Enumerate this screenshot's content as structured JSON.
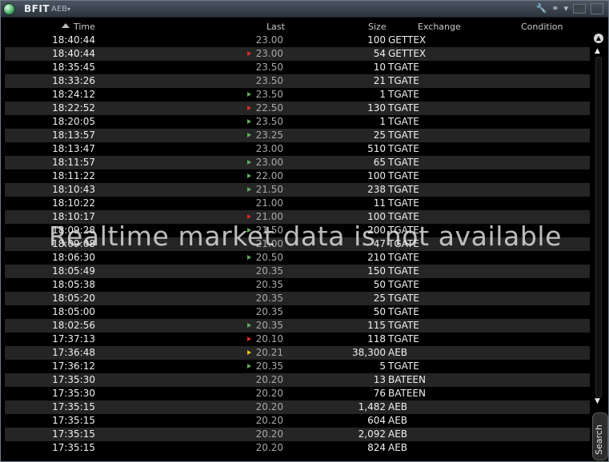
{
  "window": {
    "symbol": "BFIT",
    "exchange_selector": "AEB",
    "caret": "▾",
    "icons": [
      "wrench-icon",
      "link-icon",
      "minimize-icon",
      "maximize-icon"
    ]
  },
  "columns": {
    "time": "Time",
    "last": "Last",
    "size": "Size",
    "exchange": "Exchange",
    "condition": "Condition"
  },
  "colors": {
    "up_tick": "#5fae5f",
    "down_tick": "#e02828",
    "unchanged_tick": "#e8c21c",
    "row_alt": "#252525"
  },
  "trades": [
    {
      "time": "18:40:44",
      "last": "23.00",
      "size": "100",
      "exchange": "GETTEX",
      "tick": ""
    },
    {
      "time": "18:40:44",
      "last": "23.00",
      "size": "54",
      "exchange": "GETTEX",
      "tick": "down"
    },
    {
      "time": "18:35:45",
      "last": "23.50",
      "size": "10",
      "exchange": "TGATE",
      "tick": ""
    },
    {
      "time": "18:33:26",
      "last": "23.50",
      "size": "21",
      "exchange": "TGATE",
      "tick": ""
    },
    {
      "time": "18:24:12",
      "last": "23.50",
      "size": "1",
      "exchange": "TGATE",
      "tick": "up"
    },
    {
      "time": "18:22:52",
      "last": "22.50",
      "size": "130",
      "exchange": "TGATE",
      "tick": "down"
    },
    {
      "time": "18:20:05",
      "last": "23.50",
      "size": "1",
      "exchange": "TGATE",
      "tick": "up"
    },
    {
      "time": "18:13:57",
      "last": "23.25",
      "size": "25",
      "exchange": "TGATE",
      "tick": "up"
    },
    {
      "time": "18:13:47",
      "last": "23.00",
      "size": "510",
      "exchange": "TGATE",
      "tick": ""
    },
    {
      "time": "18:11:57",
      "last": "23.00",
      "size": "65",
      "exchange": "TGATE",
      "tick": "up"
    },
    {
      "time": "18:11:22",
      "last": "22.00",
      "size": "100",
      "exchange": "TGATE",
      "tick": "up"
    },
    {
      "time": "18:10:43",
      "last": "21.50",
      "size": "238",
      "exchange": "TGATE",
      "tick": "up"
    },
    {
      "time": "18:10:22",
      "last": "21.00",
      "size": "11",
      "exchange": "TGATE",
      "tick": ""
    },
    {
      "time": "18:10:17",
      "last": "21.00",
      "size": "100",
      "exchange": "TGATE",
      "tick": "down"
    },
    {
      "time": "18:09:28",
      "last": "21.50",
      "size": "200",
      "exchange": "TGATE",
      "tick": "up"
    },
    {
      "time": "18:09:08",
      "last": "21.00",
      "size": "47",
      "exchange": "TGATE",
      "tick": ""
    },
    {
      "time": "18:06:30",
      "last": "20.50",
      "size": "210",
      "exchange": "TGATE",
      "tick": "up"
    },
    {
      "time": "18:05:49",
      "last": "20.35",
      "size": "150",
      "exchange": "TGATE",
      "tick": ""
    },
    {
      "time": "18:05:38",
      "last": "20.35",
      "size": "50",
      "exchange": "TGATE",
      "tick": ""
    },
    {
      "time": "18:05:20",
      "last": "20.35",
      "size": "25",
      "exchange": "TGATE",
      "tick": ""
    },
    {
      "time": "18:05:00",
      "last": "20.35",
      "size": "50",
      "exchange": "TGATE",
      "tick": ""
    },
    {
      "time": "18:02:56",
      "last": "20.35",
      "size": "115",
      "exchange": "TGATE",
      "tick": "up"
    },
    {
      "time": "17:37:13",
      "last": "20.10",
      "size": "118",
      "exchange": "TGATE",
      "tick": "down"
    },
    {
      "time": "17:36:48",
      "last": "20.21",
      "size": "38,300",
      "exchange": "AEB",
      "tick": "flat"
    },
    {
      "time": "17:36:12",
      "last": "20.35",
      "size": "5",
      "exchange": "TGATE",
      "tick": "up"
    },
    {
      "time": "17:35:30",
      "last": "20.20",
      "size": "13",
      "exchange": "BATEEN",
      "tick": ""
    },
    {
      "time": "17:35:30",
      "last": "20.20",
      "size": "76",
      "exchange": "BATEEN",
      "tick": ""
    },
    {
      "time": "17:35:15",
      "last": "20.20",
      "size": "1,482",
      "exchange": "AEB",
      "tick": ""
    },
    {
      "time": "17:35:15",
      "last": "20.20",
      "size": "604",
      "exchange": "AEB",
      "tick": ""
    },
    {
      "time": "17:35:15",
      "last": "20.20",
      "size": "2,092",
      "exchange": "AEB",
      "tick": ""
    },
    {
      "time": "17:35:15",
      "last": "20.20",
      "size": "824",
      "exchange": "AEB",
      "tick": ""
    }
  ],
  "overlay_message": "Realtime market data is not available",
  "search_label": "Search"
}
